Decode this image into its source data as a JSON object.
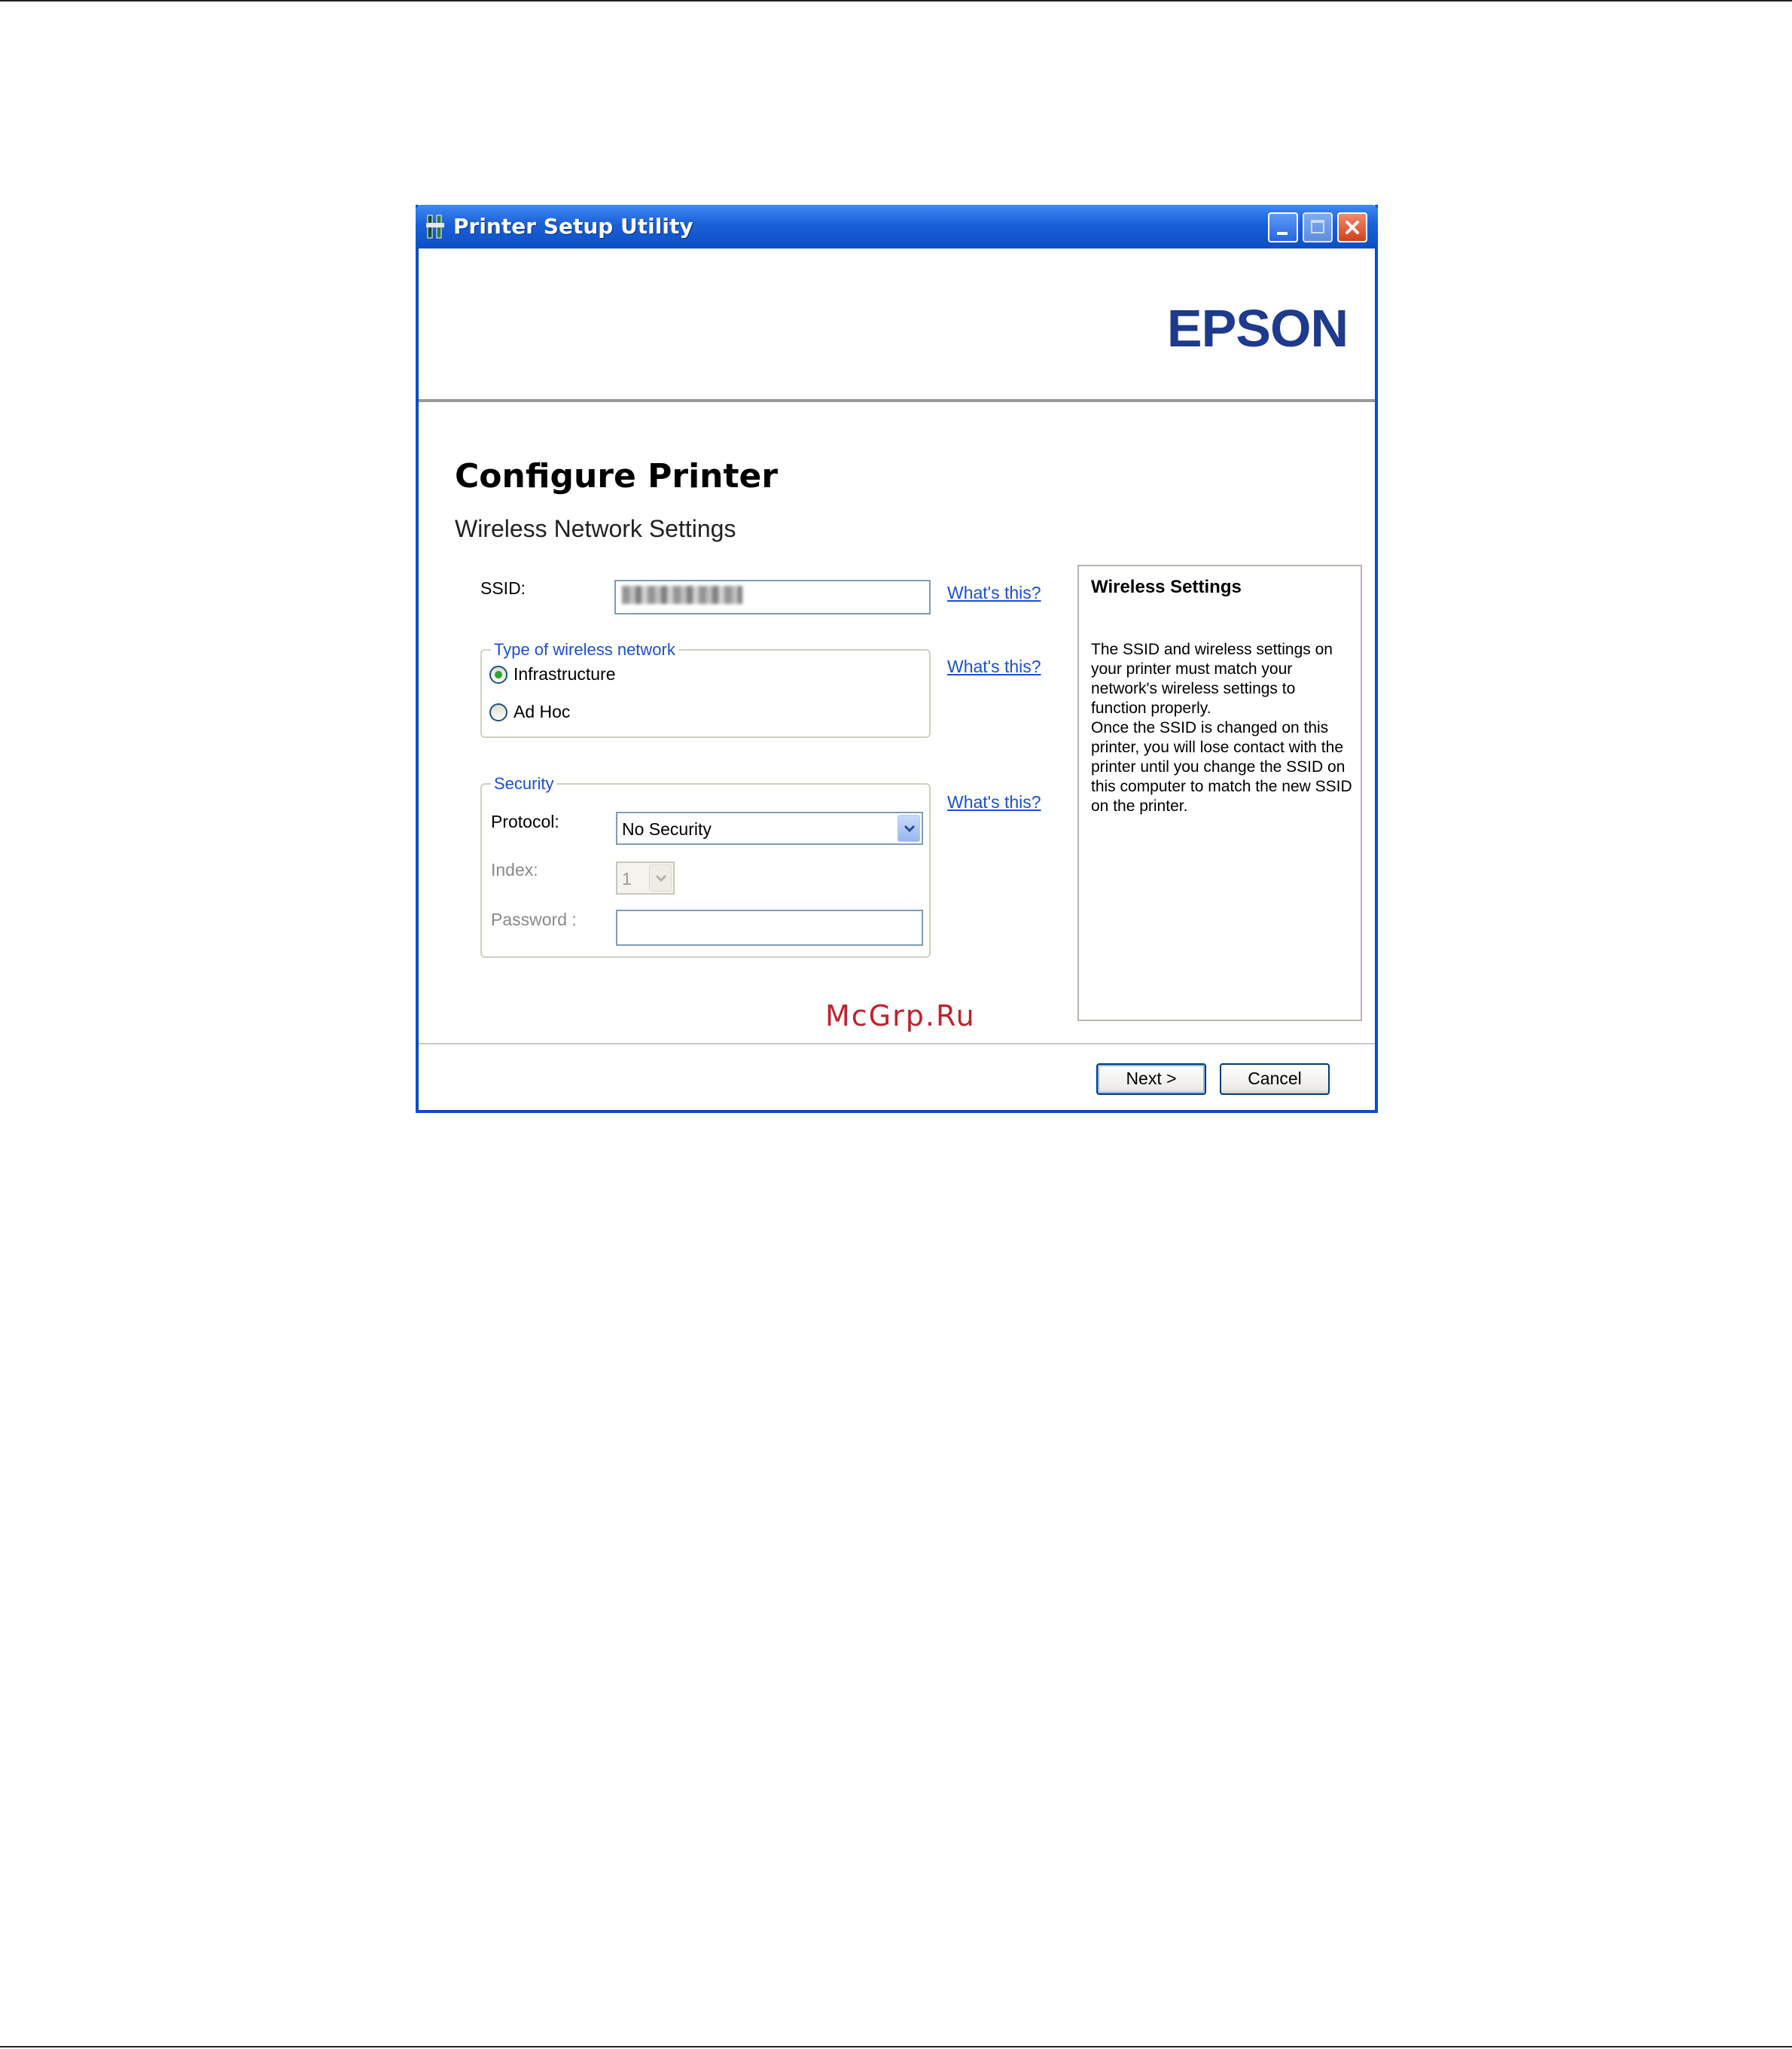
{
  "window": {
    "title": "Printer Setup Utility"
  },
  "header": {
    "brand": "EPSON"
  },
  "page": {
    "title": "Configure Printer",
    "subtitle": "Wireless Network Settings"
  },
  "form": {
    "ssid_label": "SSID:",
    "ssid_value_obscured": true,
    "network_group": {
      "legend": "Type of wireless network",
      "options": [
        {
          "label": "Infrastructure",
          "checked": true
        },
        {
          "label": "Ad Hoc",
          "checked": false
        }
      ]
    },
    "security_group": {
      "legend": "Security",
      "protocol_label": "Protocol:",
      "protocol_value": "No Security",
      "index_label": "Index:",
      "index_value": "1",
      "password_label": "Password :",
      "password_value": ""
    },
    "help_links": [
      "What's this?",
      "What's this?",
      "What's this?"
    ]
  },
  "info_panel": {
    "title": "Wireless Settings",
    "body": "The SSID and wireless settings on your printer must match your network's wireless settings to function properly.\nOnce the SSID is changed on this printer, you will lose contact with the printer until you change the SSID on this computer to match the new SSID on the printer."
  },
  "watermark": "McGrp.Ru",
  "buttons": {
    "next": "Next >",
    "cancel": "Cancel"
  },
  "colors": {
    "titlebar": "#0d4fc4",
    "brand": "#1e3a8c",
    "link": "#1a4fd6",
    "watermark": "#c0222d"
  }
}
